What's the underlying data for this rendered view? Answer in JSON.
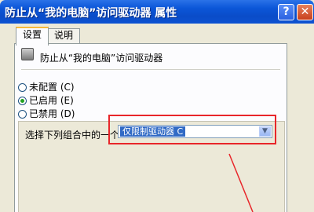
{
  "window": {
    "title": "防止从“我的电脑”访问驱动器 属性",
    "help_glyph": "?",
    "close_glyph": "✕"
  },
  "tabs": [
    {
      "label": "设置",
      "active": true
    },
    {
      "label": "说明",
      "active": false
    }
  ],
  "header": {
    "text": "防止从“我的电脑”访问驱动器",
    "icon": "policy-icon"
  },
  "options": [
    {
      "label": "未配置 (C)",
      "checked": false
    },
    {
      "label": "已启用 (E)",
      "checked": true
    },
    {
      "label": "已禁用 (D)",
      "checked": false
    }
  ],
  "combo": {
    "label": "选择下列组合中的一个",
    "value": "仅限制驱动器 C",
    "arrow_glyph": "▼"
  },
  "colors": {
    "titlebar": "#0b56d8",
    "annotation": "#e8262a",
    "selected": "#316ac5"
  }
}
